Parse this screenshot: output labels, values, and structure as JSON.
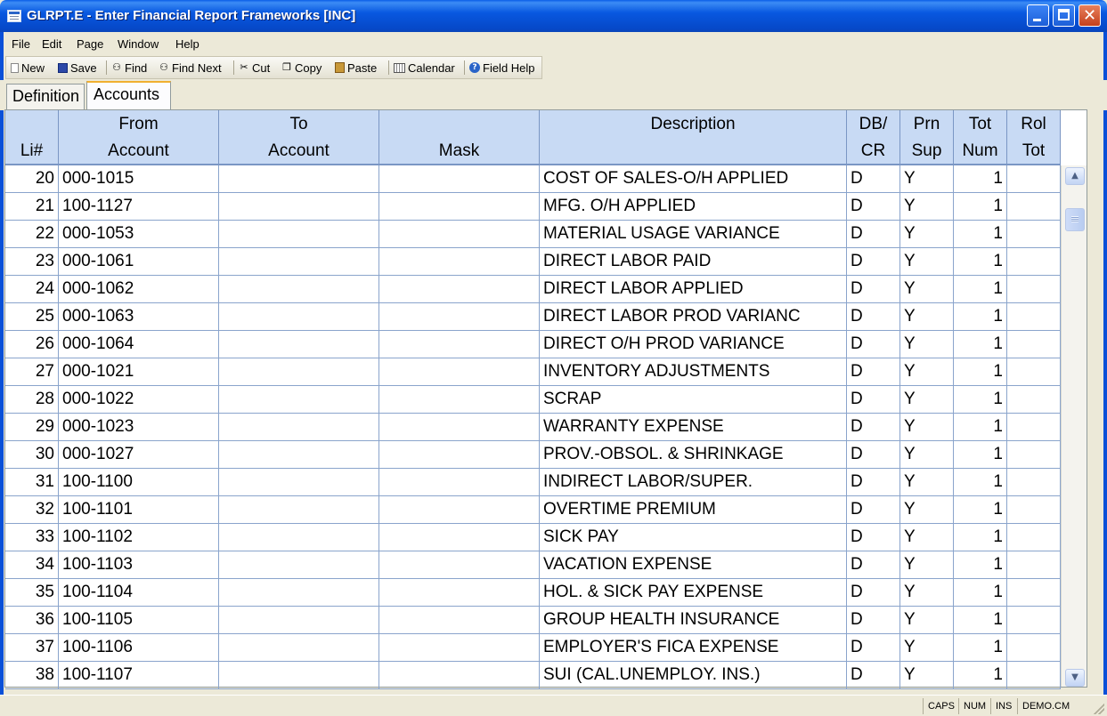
{
  "window": {
    "title": "GLRPT.E - Enter Financial Report Frameworks [INC]"
  },
  "menu": {
    "items": [
      {
        "label": "File"
      },
      {
        "label": "Edit"
      },
      {
        "label": "Page"
      },
      {
        "label": "Window"
      },
      {
        "label": "Help"
      }
    ]
  },
  "toolbar": {
    "new": "New",
    "save": "Save",
    "find": "Find",
    "find_next": "Find Next",
    "cut": "Cut",
    "copy": "Copy",
    "paste": "Paste",
    "calendar": "Calendar",
    "field_help": "Field Help"
  },
  "tabs": {
    "definition": "Definition",
    "accounts": "Accounts"
  },
  "grid": {
    "headers": [
      {
        "l1": "",
        "l2": "Li#"
      },
      {
        "l1": "From",
        "l2": "Account"
      },
      {
        "l1": "To",
        "l2": "Account"
      },
      {
        "l1": "",
        "l2": "Mask"
      },
      {
        "l1": "Description",
        "l2": ""
      },
      {
        "l1": "DB/",
        "l2": "CR"
      },
      {
        "l1": "Prn",
        "l2": "Sup"
      },
      {
        "l1": "Tot",
        "l2": "Num"
      },
      {
        "l1": "Rol",
        "l2": "Tot"
      }
    ],
    "rows": [
      [
        "20",
        "000-1015",
        "",
        "",
        "COST OF SALES-O/H APPLIED",
        "D",
        "Y",
        "1",
        ""
      ],
      [
        "21",
        "100-1127",
        "",
        "",
        "MFG. O/H APPLIED",
        "D",
        "Y",
        "1",
        ""
      ],
      [
        "22",
        "000-1053",
        "",
        "",
        "MATERIAL USAGE VARIANCE",
        "D",
        "Y",
        "1",
        ""
      ],
      [
        "23",
        "000-1061",
        "",
        "",
        "DIRECT LABOR PAID",
        "D",
        "Y",
        "1",
        ""
      ],
      [
        "24",
        "000-1062",
        "",
        "",
        "DIRECT LABOR APPLIED",
        "D",
        "Y",
        "1",
        ""
      ],
      [
        "25",
        "000-1063",
        "",
        "",
        "DIRECT LABOR PROD VARIANC",
        "D",
        "Y",
        "1",
        ""
      ],
      [
        "26",
        "000-1064",
        "",
        "",
        "DIRECT O/H PROD VARIANCE",
        "D",
        "Y",
        "1",
        ""
      ],
      [
        "27",
        "000-1021",
        "",
        "",
        "INVENTORY ADJUSTMENTS",
        "D",
        "Y",
        "1",
        ""
      ],
      [
        "28",
        "000-1022",
        "",
        "",
        "SCRAP",
        "D",
        "Y",
        "1",
        ""
      ],
      [
        "29",
        "000-1023",
        "",
        "",
        "WARRANTY EXPENSE",
        "D",
        "Y",
        "1",
        ""
      ],
      [
        "30",
        "000-1027",
        "",
        "",
        "PROV.-OBSOL. & SHRINKAGE",
        "D",
        "Y",
        "1",
        ""
      ],
      [
        "31",
        "100-1100",
        "",
        "",
        "INDIRECT LABOR/SUPER.",
        "D",
        "Y",
        "1",
        ""
      ],
      [
        "32",
        "100-1101",
        "",
        "",
        "OVERTIME PREMIUM",
        "D",
        "Y",
        "1",
        ""
      ],
      [
        "33",
        "100-1102",
        "",
        "",
        "SICK PAY",
        "D",
        "Y",
        "1",
        ""
      ],
      [
        "34",
        "100-1103",
        "",
        "",
        "VACATION EXPENSE",
        "D",
        "Y",
        "1",
        ""
      ],
      [
        "35",
        "100-1104",
        "",
        "",
        "HOL. & SICK PAY EXPENSE",
        "D",
        "Y",
        "1",
        ""
      ],
      [
        "36",
        "100-1105",
        "",
        "",
        "GROUP HEALTH INSURANCE",
        "D",
        "Y",
        "1",
        ""
      ],
      [
        "37",
        "100-1106",
        "",
        "",
        "EMPLOYER'S FICA EXPENSE",
        "D",
        "Y",
        "1",
        ""
      ],
      [
        "38",
        "100-1107",
        "",
        "",
        "SUI (CAL.UNEMPLOY. INS.)",
        "D",
        "Y",
        "1",
        ""
      ]
    ]
  },
  "status": {
    "caps": "CAPS",
    "num": "NUM",
    "ins": "INS",
    "account": "DEMO.CM"
  },
  "colors": {
    "title_bar": "#0858e0",
    "grid_header": "#c8daf4",
    "active_tab_accent": "#f0b030"
  }
}
